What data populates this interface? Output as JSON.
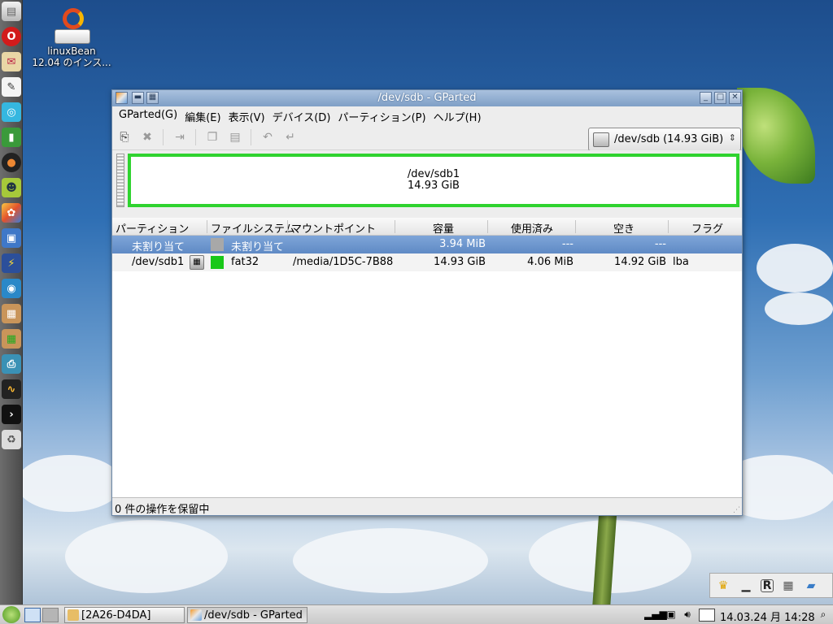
{
  "desktop": {
    "icon_label_line1": "linuxBean",
    "icon_label_line2": "12.04 のインス..."
  },
  "dock": {
    "icons": [
      "files-icon",
      "opera-icon",
      "mail-icon",
      "text-editor-icon",
      "app-store-icon",
      "notes-icon",
      "media-player-icon",
      "android-icon",
      "paint-icon",
      "image-viewer-icon",
      "tool-icon",
      "network-icon",
      "package-icon",
      "package-install-icon",
      "printer-icon",
      "system-monitor-icon",
      "terminal-icon",
      "trash-icon"
    ]
  },
  "window": {
    "title": "/dev/sdb - GParted",
    "menu": [
      "GParted(G)",
      "編集(E)",
      "表示(V)",
      "デバイス(D)",
      "パーティション(P)",
      "ヘルプ(H)"
    ],
    "device_selector": "/dev/sdb   (14.93 GiB)",
    "diskmap": {
      "partition_name": "/dev/sdb1",
      "partition_size": "14.93 GiB",
      "partition_color": "#2fd32f"
    },
    "columns": {
      "partition": "パーティション",
      "filesystem": "ファイルシステム",
      "mountpoint": "マウントポイント",
      "size": "容量",
      "used": "使用済み",
      "free": "空き",
      "flags": "フラグ"
    },
    "rows": [
      {
        "partition": "未割り当て",
        "filesystem": "未割り当て",
        "fs_color": "#a8a8a8",
        "mountpoint": "",
        "size": "3.94 MiB",
        "used": "---",
        "free": "---",
        "flags": "",
        "selected": true
      },
      {
        "partition": "/dev/sdb1",
        "filesystem": "fat32",
        "fs_color": "#18c818",
        "mountpoint": "/media/1D5C-7B88",
        "size": "14.93 GiB",
        "used": "4.06 MiB",
        "free": "14.92 GiB",
        "flags": "lba",
        "selected": false
      }
    ],
    "status": "0 件の操作を保留中"
  },
  "taskbar": {
    "tasks": [
      "[2A26-D4DA]",
      "/dev/sdb - GParted"
    ],
    "clock": "14.03.24 月 14:28"
  }
}
